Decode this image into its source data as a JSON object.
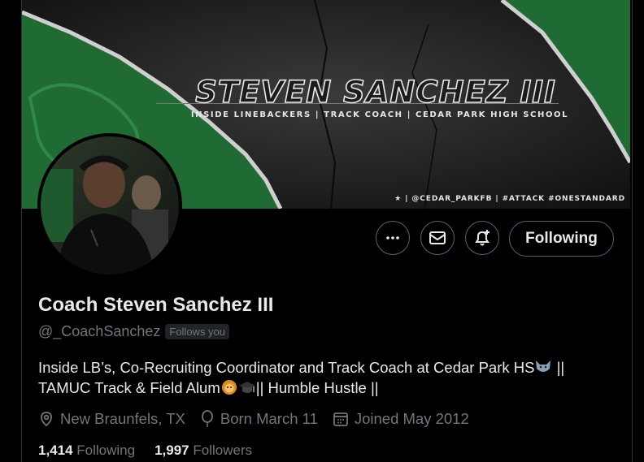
{
  "banner": {
    "name": "STEVEN SANCHEZ III",
    "subtitle": "INSIDE LINEBACKERS | TRACK COACH | CEDAR PARK HIGH SCHOOL",
    "handle_line": "| @CEDAR_PARKFB | #ATTACK #ONESTANDARD"
  },
  "actions": {
    "following_label": "Following"
  },
  "profile": {
    "display_name": "Coach Steven Sanchez III",
    "handle": "@_CoachSanchez",
    "follows_you": "Follows you",
    "bio_line1_a": "Inside LB’s, Co-Recruiting Coordinator and Track Coach at Cedar Park HS",
    "bio_line1_b": " ||",
    "bio_line2_a": "TAMUC Track & Field Alum",
    "bio_line2_b": "|| Humble Hustle ||",
    "location": "New Braunfels, TX",
    "birthday": "Born March 11",
    "joined": "Joined May 2012"
  },
  "stats": {
    "following_count": "1,414",
    "following_label": "Following",
    "followers_count": "1,997",
    "followers_label": "Followers"
  },
  "icons": {
    "more": "more-icon",
    "message": "mail-icon",
    "notify": "bell-plus-icon",
    "location": "location-pin-icon",
    "birthday": "balloon-icon",
    "joined": "calendar-icon"
  },
  "colors": {
    "background": "#000000",
    "text": "#e7e9ea",
    "secondary": "#71767b",
    "border": "#536471",
    "banner_green": "#1f6b33"
  }
}
